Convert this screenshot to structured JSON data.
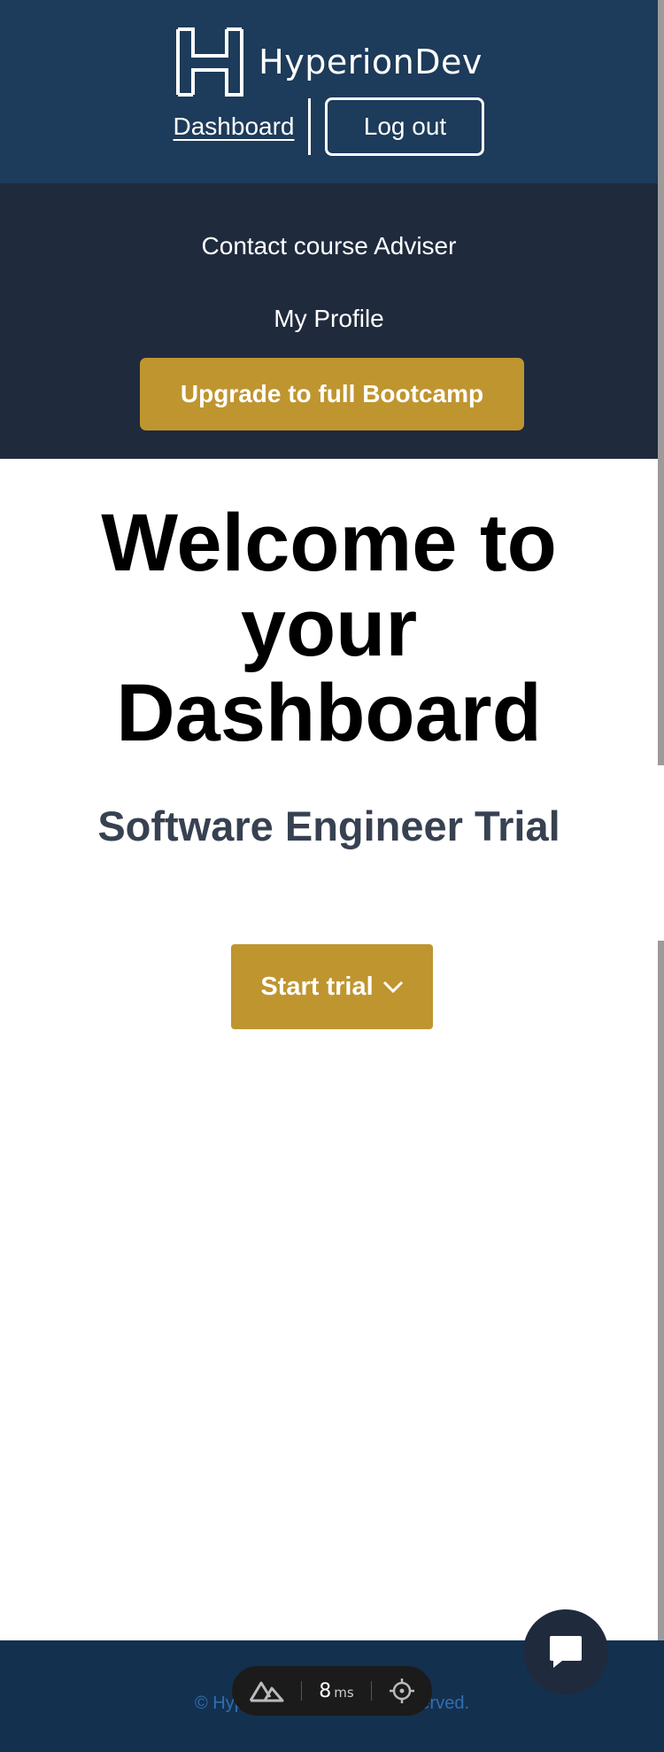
{
  "brand": {
    "name": "HyperionDev",
    "logo_icon": "hyperiondev-h-logo-icon"
  },
  "header": {
    "dashboard_link": "Dashboard",
    "logout_button": "Log out"
  },
  "subnav": {
    "contact_link": "Contact course Adviser",
    "profile_link": "My Profile",
    "upgrade_button": "Upgrade to full Bootcamp"
  },
  "main": {
    "title": "Welcome to your Dashboard",
    "subtitle": "Software Engineer Trial",
    "start_button": "Start trial",
    "start_button_icon": "chevron-down-icon"
  },
  "footer": {
    "copyright": "© HyperionDev. All rights reserved."
  },
  "chat": {
    "icon": "chat-bubble-icon"
  },
  "dev_badge": {
    "icon": "nuxt-icon",
    "value": "8",
    "unit": "ms",
    "inspect_icon": "crosshair-icon"
  },
  "colors": {
    "header_bg": "#1d3b5a",
    "subnav_bg": "#1f2a3d",
    "accent_gold": "#bf9530",
    "footer_bg": "#14304f",
    "subtitle_text": "#374151"
  }
}
